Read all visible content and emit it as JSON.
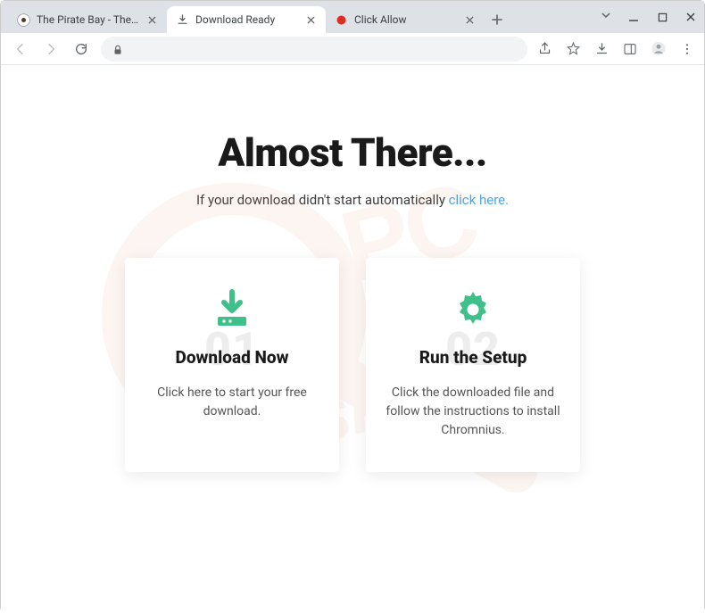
{
  "tabs": [
    {
      "title": "The Pirate Bay - The galaxy's mo...",
      "active": false,
      "favicon": "piratebay"
    },
    {
      "title": "Download Ready",
      "active": true,
      "favicon": "download"
    },
    {
      "title": "Click Allow",
      "active": false,
      "favicon": "red-dot"
    }
  ],
  "hero": {
    "title": "Almost There...",
    "subtitle_before": "If your download didn't start automatically ",
    "subtitle_link": "click here."
  },
  "cards": [
    {
      "num": "01",
      "icon": "download",
      "title": "Download Now",
      "desc": "Click here to start your free download."
    },
    {
      "num": "02",
      "icon": "gear",
      "title": "Run the Setup",
      "desc": "Click the downloaded file and follow the instructions to install Chromnius."
    }
  ]
}
